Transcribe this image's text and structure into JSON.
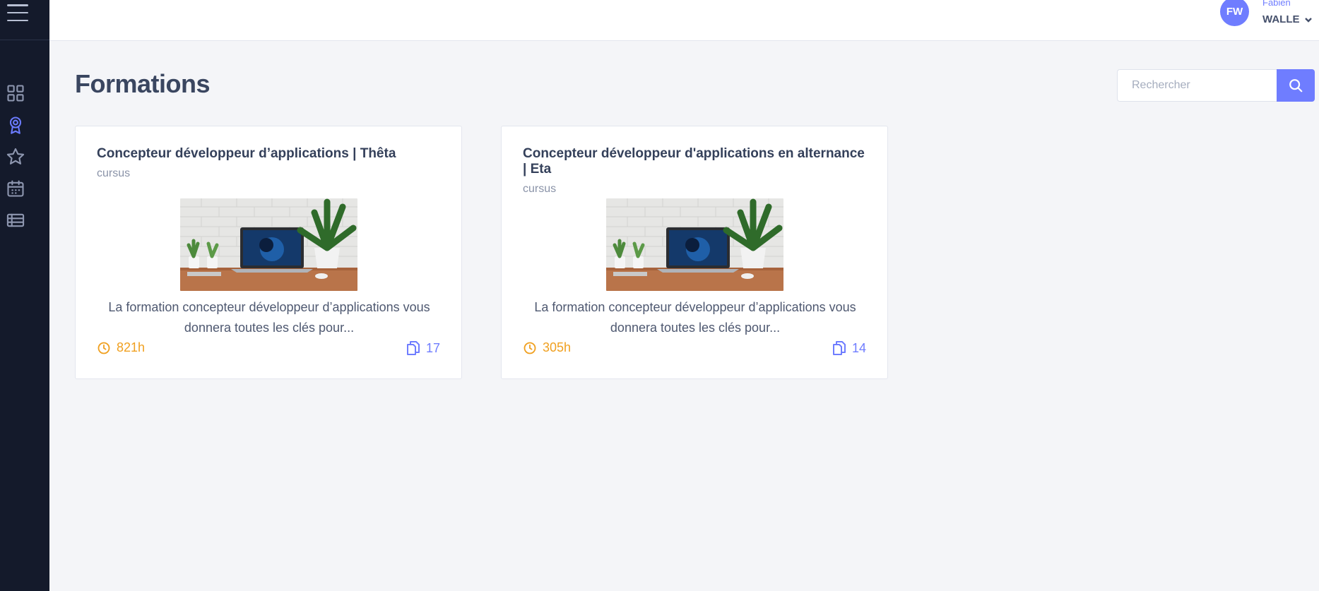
{
  "header": {
    "avatar_initials": "FW",
    "user_first_name": "Fabien",
    "user_last_name": "WALLE"
  },
  "sidebar": {
    "items": [
      {
        "icon": "dashboard-icon",
        "active": false
      },
      {
        "icon": "award-icon",
        "active": true
      },
      {
        "icon": "star-icon",
        "active": false
      },
      {
        "icon": "calendar-icon",
        "active": false
      },
      {
        "icon": "list-icon",
        "active": false
      }
    ]
  },
  "page": {
    "title": "Formations"
  },
  "search": {
    "placeholder": "Rechercher"
  },
  "cards": [
    {
      "title": "Concepteur développeur d’applications | Thêta",
      "type": "cursus",
      "description": "La formation concepteur développeur d’applications vous donnera toutes les clés pour...",
      "duration": "821h",
      "count": "17"
    },
    {
      "title": "Concepteur développeur d'applications en alternance | Eta",
      "type": "cursus",
      "description": "La formation concepteur développeur d’applications vous donnera toutes les clés pour...",
      "duration": "305h",
      "count": "14"
    }
  ],
  "colors": {
    "accent": "#6f7dff",
    "duration": "#f0a020",
    "sidebar_bg": "#141a2b"
  }
}
